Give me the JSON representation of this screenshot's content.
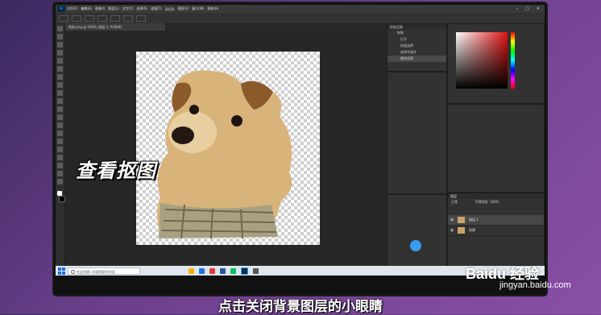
{
  "app": {
    "icon_label": "Ps",
    "menu": [
      "文件(F)",
      "编辑(E)",
      "图像(I)",
      "图层(L)",
      "文字(Y)",
      "选择(S)",
      "滤镜(T)",
      "3D(D)",
      "视图(V)",
      "窗口(W)",
      "帮助(H)"
    ],
    "document_tab": "狗狗.png @ 100% (图层 1, RGB/8)"
  },
  "history_panel": {
    "title": "历史记录",
    "items": [
      "狗狗",
      "打开",
      "快速选择",
      "选择并遮住",
      "删除背景"
    ]
  },
  "layers_panel": {
    "title": "图层",
    "mode": "正常",
    "opacity_label": "不透明度: 100%",
    "layers": [
      {
        "name": "图层 1",
        "selected": true
      },
      {
        "name": "背景",
        "selected": false
      }
    ]
  },
  "taskbar": {
    "search_placeholder": "在这里输入你要搜索的内容"
  },
  "overlay": {
    "caption": "查看抠图",
    "subtitle": "点击关闭背景图层的小眼睛",
    "watermark": "Baidu 经验",
    "watermark_url": "jingyan.baidu.com"
  }
}
